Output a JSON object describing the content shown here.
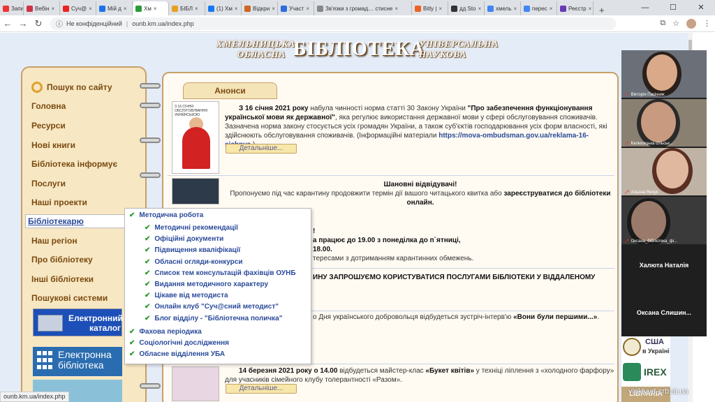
{
  "browser": {
    "tabs": [
      {
        "label": "Запис",
        "color": "#e33",
        "active": false
      },
      {
        "label": "Вебін",
        "color": "#c34",
        "active": false
      },
      {
        "label": "Суч@",
        "color": "#e22",
        "active": false
      },
      {
        "label": "Мій д",
        "color": "#1a73e8",
        "active": false
      },
      {
        "label": "Хм",
        "color": "#2a9a3a",
        "active": true
      },
      {
        "label": "БІБЛ",
        "color": "#e8a020",
        "active": false
      },
      {
        "label": "(1) Хм",
        "color": "#1877f2",
        "active": false
      },
      {
        "label": "Відкри",
        "color": "#c62",
        "active": false
      },
      {
        "label": "Участ",
        "color": "#2d6cdf",
        "active": false
      },
      {
        "label": "Зв'язки з громад… стисне",
        "color": "#888",
        "active": false
      },
      {
        "label": "Bitly |",
        "color": "#ee6123",
        "active": false
      },
      {
        "label": "дд Sto",
        "color": "#333",
        "active": false
      },
      {
        "label": "хмель",
        "color": "#4285f4",
        "active": false
      },
      {
        "label": "перес",
        "color": "#4285f4",
        "active": false
      },
      {
        "label": "Реєстр",
        "color": "#673ab7",
        "active": false
      }
    ],
    "new_tab": "+",
    "controls": [
      "—",
      "☐",
      "✕"
    ],
    "security_text": "Не конфіденційний",
    "url": "ounb.km.ua/index.php",
    "status_url": "ounb.km.ua/index.php"
  },
  "site": {
    "banner_left_top": "ХМЕЛЬНИЦЬКА",
    "banner_left_bottom": "ОБЛАСНА",
    "banner_big": "БІБЛІОТЕКА",
    "banner_right_top": "УНІВЕРСАЛЬНА",
    "banner_right_bottom": "НАУКОВА",
    "search_label": "Пошук по сайту",
    "menu": [
      "Головна",
      "Ресурси",
      "Нові книги",
      "Бібліотека інформує",
      "Послуги",
      "Наші проекти"
    ],
    "active_menu": "Бібліотекарю",
    "menu_after": [
      "Наш регіон",
      "Про бібліотеку",
      "Інші бібліотеки",
      "Пошукові системи"
    ],
    "ecatalog_line1": "Електронний",
    "ecatalog_line2": "каталог",
    "elibrary_line1": "Електронна",
    "elibrary_line2": "бібліотека",
    "anons_title": "Анонси",
    "more_label": "Детальніше...",
    "news1_date": "З 16 січня 2021 року",
    "news1_text1": " набула  чинності норма статті 30 Закону України ",
    "news1_law": "\"Про забезпечення функціонування української мови як державної\"",
    "news1_text2": ", яка регулює використання державної мови у сфері обслуговування споживачів. Зазначена норма закону стосується усіх громадян України, а також суб'єктів господарювання усіх форм власності, які здійснюють обслуговування споживачів. (Інформаційні матеріали ",
    "news1_link": "https://mova-ombudsman.gov.ua/reklama-16-sichnya",
    "news1_text3": " )",
    "thumb1_label": "З 16 СІЧНЯ ОБСЛУГОВУВАННЯ УКРАЇНСЬКОЮ",
    "news2_title": "Шановні відвідувачі!",
    "news2_text": "Пропонуємо під час карантину продовжити термін дії вашого читацького квитка або ",
    "news2_bold": "зареєструватися до бібліотеки онлайн.",
    "news3_line1": "!",
    "news3_line2": "а працює до 19.00 з понеділка до п`ятниці,",
    "news3_line3": "18.00.",
    "news3_line4": "тересами з дотриманням карантинних обмежень.",
    "news4_line": "ИНУ ЗАПРОШУЄМО КОРИСТУВАТИСЯ ПОСЛУГАМИ БІБЛІОТЕКИ У ВІДДАЛЕНОМУ",
    "news5_text": "о Дня українського добровольця відбудеться зустріч-інтерв'ю ",
    "news5_bold": "«Вони були першими...»",
    "news5_end": ".",
    "news6_date": "14 березня 2021 року о 14.00",
    "news6_text": " відбудеться майстер-клас ",
    "news6_bold": "«Букет квітів»",
    "news6_text2": " у техніці ліплення з «холодного фарфору» для учасників сімейного клубу  толерантності «Разом».",
    "dropdown": {
      "top": "Методична робота",
      "sub": [
        "Методичні рекомендації",
        "Офіційні документи",
        "Підвищення кваліфікації",
        "Обласні огляди-конкурси",
        "Список тем консультацій фахівців ОУНБ",
        "Видання методичного характеру",
        "Цікаве від методиста",
        "Онлайн клуб \"Суч@сний методист\"",
        "Блог відділу - \"Бібліотечна поличка\""
      ],
      "bottom": [
        "Фахова періодика",
        "Соціологічні дослідження",
        "Обласне відділення УБА"
      ]
    },
    "usa_text1": "США",
    "usa_text2": "в Україні",
    "irex_text": "IREX",
    "libria_text": "LIBRARIA"
  },
  "video": {
    "participants": [
      "Вікторія Пасічник",
      "Калюсецька сільськ...",
      "Альона Янчук",
      "Оксана_бібліотека_фі..."
    ],
    "text_only": [
      "Халюта Наталія",
      "Оксана  Слишин..."
    ]
  },
  "watermark": "vinklyvd-crb.at.ua",
  "colors": {
    "menu_text": "#7a4a10",
    "link": "#2a4a9a",
    "check": "#2a9a2a"
  }
}
